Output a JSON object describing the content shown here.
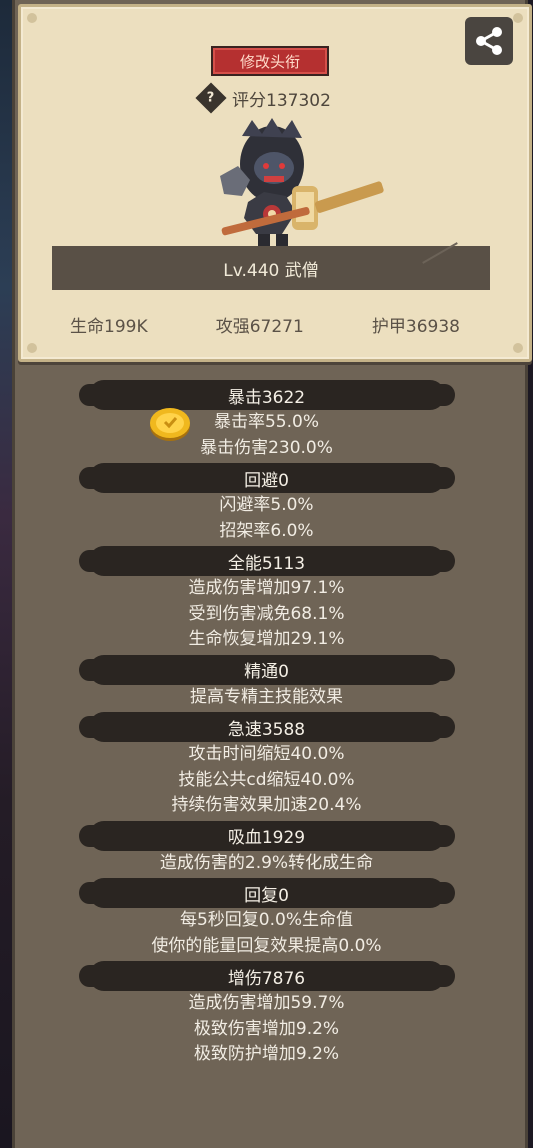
{
  "profile": {
    "title_button": "修改头衔",
    "help_icon": "?",
    "score": "评分137302",
    "level_name": "Lv.440 武僧",
    "stats": [
      "生命199K",
      "攻强67271",
      "护甲36938"
    ]
  },
  "attributes": [
    {
      "header": "暴击3622",
      "lines": [
        "暴击率55.0%",
        "暴击伤害230.0%"
      ]
    },
    {
      "header": "回避0",
      "lines": [
        "闪避率5.0%",
        "招架率6.0%"
      ]
    },
    {
      "header": "全能5113",
      "lines": [
        "造成伤害增加97.1%",
        "受到伤害减免68.1%",
        "生命恢复增加29.1%"
      ]
    },
    {
      "header": "精通0",
      "lines": [
        "提高专精主技能效果"
      ]
    },
    {
      "header": "急速3588",
      "lines": [
        "攻击时间缩短40.0%",
        "技能公共cd缩短40.0%",
        "持续伤害效果加速20.4%"
      ]
    },
    {
      "header": "吸血1929",
      "lines": [
        "造成伤害的2.9%转化成生命"
      ]
    },
    {
      "header": "回复0",
      "lines": [
        "每5秒回复0.0%生命值",
        "使你的能量回复效果提高0.0%"
      ]
    },
    {
      "header": "增伤7876",
      "lines": [
        "造成伤害增加59.7%",
        "极致伤害增加9.2%",
        "极致防护增加9.2%"
      ]
    }
  ],
  "icons": [
    "share-icon",
    "help-icon",
    "hero-avatar",
    "gold-coin-icon"
  ],
  "colors": {
    "title_button": "#b53030",
    "card": "#ecdfbf",
    "panel": "#6f6456",
    "header_bar": "#2a2521"
  }
}
